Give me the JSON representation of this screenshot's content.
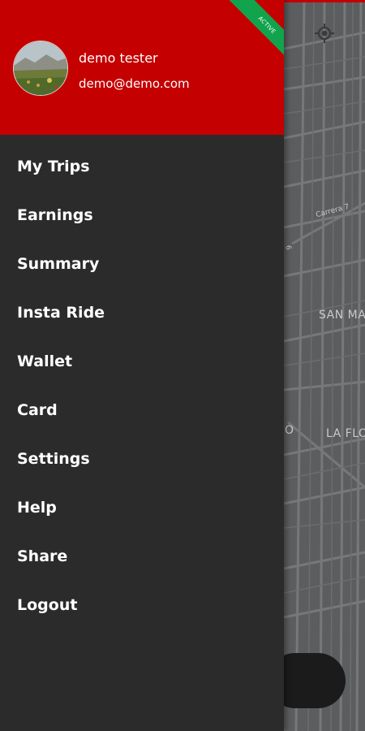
{
  "map": {
    "labels": {
      "carrera": "Carrera 7",
      "side_street": "6",
      "district_1": "SAN MA",
      "district_2": "LA FLO",
      "fragment": "O"
    }
  },
  "drawer": {
    "user": {
      "name": "demo tester",
      "email": "demo@demo.com"
    },
    "status_badge": "ACTIVE",
    "menu": [
      {
        "label": "My Trips"
      },
      {
        "label": "Earnings"
      },
      {
        "label": "Summary"
      },
      {
        "label": "Insta Ride"
      },
      {
        "label": "Wallet"
      },
      {
        "label": "Card"
      },
      {
        "label": "Settings"
      },
      {
        "label": "Help"
      },
      {
        "label": "Share"
      },
      {
        "label": "Logout"
      }
    ]
  },
  "icons": {
    "locate": "crosshair-gps-icon"
  },
  "colors": {
    "header": "#c40000",
    "drawer_bg": "#2b2b2b",
    "badge": "#12a34d",
    "map": "#5c5d5f"
  }
}
